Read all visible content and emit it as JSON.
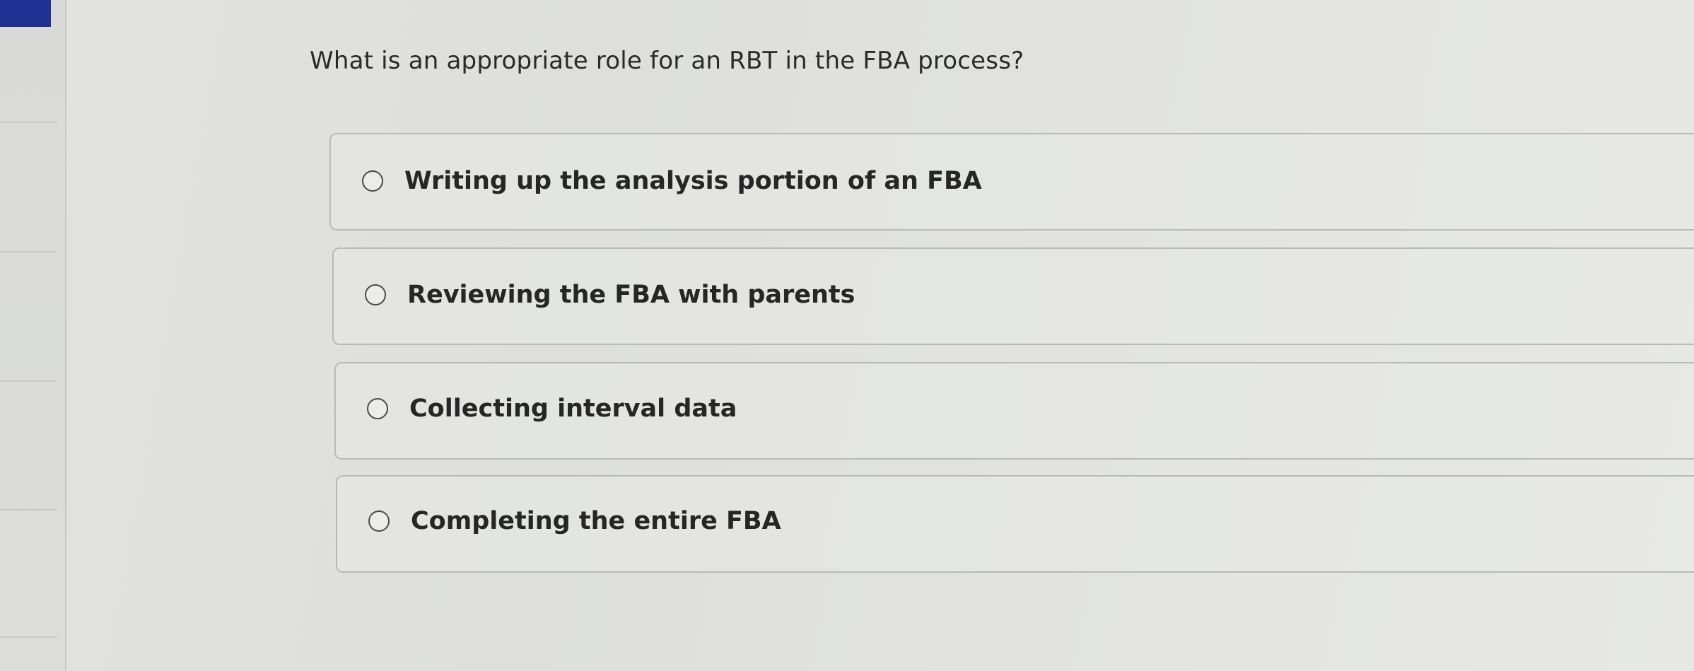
{
  "question": {
    "text": "What is an appropriate role for an RBT in the FBA process?"
  },
  "options": [
    {
      "label": "Writing up the analysis portion of an FBA",
      "selected": false
    },
    {
      "label": "Reviewing the FBA with parents",
      "selected": false
    },
    {
      "label": "Collecting interval data",
      "selected": false
    },
    {
      "label": "Completing the entire FBA",
      "selected": false
    }
  ],
  "colors": {
    "accent": "#1f2f92",
    "text": "#262626",
    "border": "#b9bab7"
  }
}
